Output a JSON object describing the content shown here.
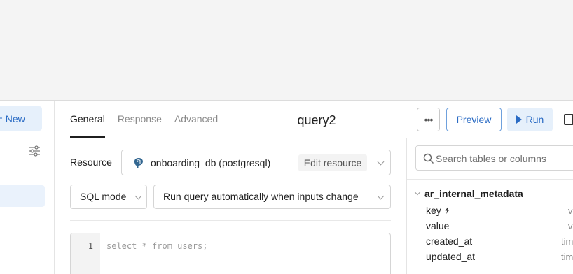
{
  "sidebar": {
    "new_label": "New",
    "plus": "+"
  },
  "tabs": [
    {
      "label": "General",
      "active": true
    },
    {
      "label": "Response",
      "active": false
    },
    {
      "label": "Advanced",
      "active": false
    }
  ],
  "query_title": "query2",
  "toolbar": {
    "more": "•••",
    "preview": "Preview",
    "run": "Run"
  },
  "resource": {
    "label": "Resource",
    "name": "onboarding_db (postgresql)",
    "edit": "Edit resource"
  },
  "mode": {
    "value": "SQL mode"
  },
  "trigger": {
    "value": "Run query automatically when inputs change"
  },
  "editor": {
    "line": "1",
    "code": "select * from users;"
  },
  "schema": {
    "search_placeholder": "Search tables or columns",
    "table": "ar_internal_metadata",
    "columns": [
      {
        "name": "key",
        "type": "v",
        "primary": true
      },
      {
        "name": "value",
        "type": "v"
      },
      {
        "name": "created_at",
        "type": "tim"
      },
      {
        "name": "updated_at",
        "type": "tim"
      }
    ]
  },
  "colors": {
    "accent": "#2a6bc4",
    "accent_bg": "#e6f0fb"
  }
}
